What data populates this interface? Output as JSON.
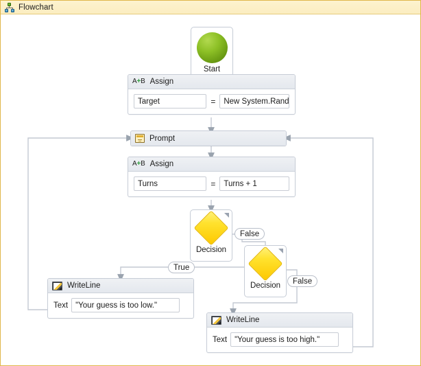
{
  "window": {
    "title": "Flowchart",
    "icon": "flowchart-icon",
    "border_color": "#e0b64a",
    "header_bg": "#fbedc0"
  },
  "nodes": {
    "start": {
      "label": "Start",
      "icon": "green-circle-start-icon",
      "color": "#8dc026"
    },
    "assign_target": {
      "title": "Assign",
      "icon": "assign-ab-icon",
      "to": "Target",
      "operator": "=",
      "value": "New System.Randc"
    },
    "prompt": {
      "title": "Prompt",
      "icon": "prompt-window-icon"
    },
    "assign_turns": {
      "title": "Assign",
      "icon": "assign-ab-icon",
      "to": "Turns",
      "operator": "=",
      "value": "Turns + 1"
    },
    "decision_1": {
      "label": "Decision",
      "icon": "yellow-diamond-icon",
      "color": "#ffe22e"
    },
    "decision_2": {
      "label": "Decision",
      "icon": "yellow-diamond-icon",
      "color": "#ffe22e"
    },
    "writeline_low": {
      "title": "WriteLine",
      "icon": "writeline-console-icon",
      "field_label": "Text",
      "field_value": "\"Your guess is too low.\""
    },
    "writeline_high": {
      "title": "WriteLine",
      "icon": "writeline-console-icon",
      "field_label": "Text",
      "field_value": "\"Your guess is too high.\""
    }
  },
  "connector_labels": {
    "decision1_false": "False",
    "decision2_true": "True",
    "decision2_false": "False"
  }
}
